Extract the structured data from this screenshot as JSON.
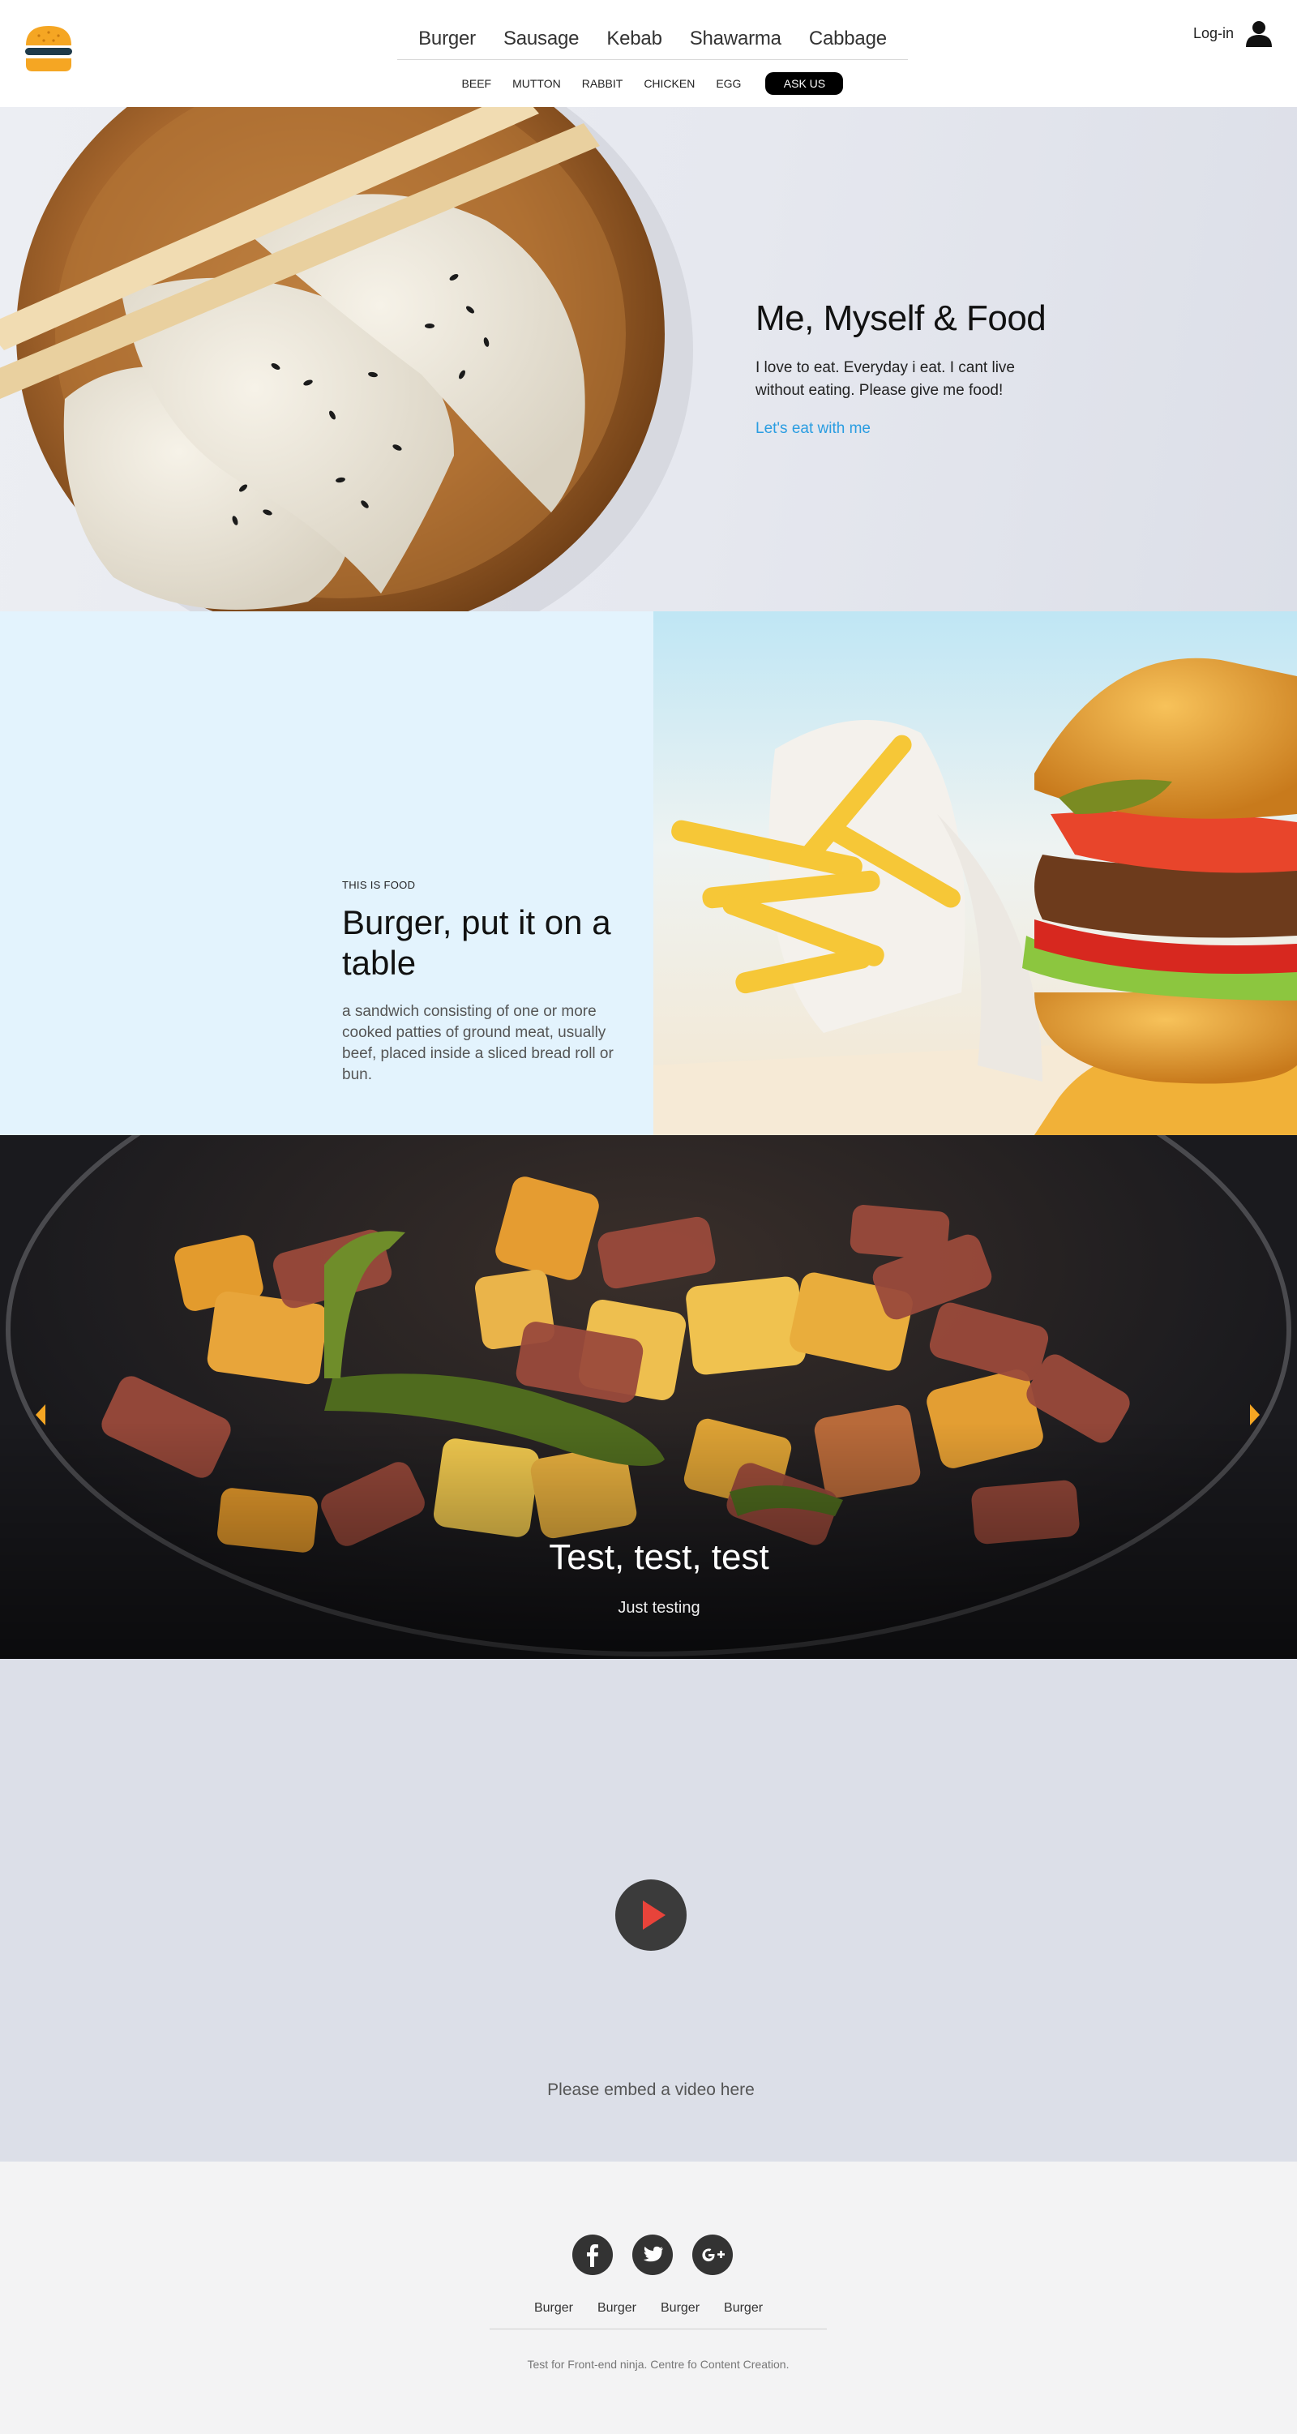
{
  "header": {
    "nav": [
      "Burger",
      "Sausage",
      "Kebab",
      "Shawarma",
      "Cabbage"
    ],
    "subnav": [
      "BEEF",
      "MUTTON",
      "RABBIT",
      "CHICKEN",
      "EGG"
    ],
    "ask_button": "ASK US",
    "login_label": "Log-in",
    "logo_icon": "burger-logo-icon",
    "user_icon": "user-icon"
  },
  "hero": {
    "title": "Me, Myself & Food",
    "description": "I love to eat. Everyday i eat. I cant live without eating. Please give me food!",
    "link_label": "Let's eat with me",
    "link_color": "#2a9de1",
    "image": "dumplings-on-wooden-plate-with-chopsticks"
  },
  "burger_section": {
    "eyebrow": "THIS IS FOOD",
    "title": "Burger, put it on a table",
    "description": "a sandwich consisting of one or more cooked patties of ground meat, usually beef, placed inside a sliced bread roll or bun.",
    "background": "#e3f3fd",
    "image": "burger-and-fries"
  },
  "slider": {
    "title": "Test, test, test",
    "subtitle": "Just testing",
    "arrow_color": "#f5a623",
    "image": "stir-fry-in-pan"
  },
  "video": {
    "caption": "Please embed a video here",
    "play_icon": "play-icon",
    "play_color": "#e8433a"
  },
  "footer": {
    "social": [
      "facebook-icon",
      "twitter-icon",
      "google-plus-icon"
    ],
    "links": [
      "Burger",
      "Burger",
      "Burger",
      "Burger"
    ],
    "copyright": "Test for Front-end ninja. Centre fo Content Creation."
  }
}
